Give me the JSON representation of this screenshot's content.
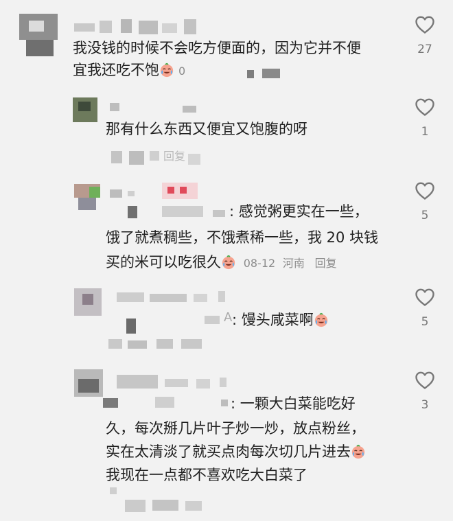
{
  "comments": [
    {
      "text_lines": [
        "我没钱的时候不会吃方便面的，因为它并不便",
        "宜我还吃不饱"
      ],
      "after_emoji": "0",
      "likes": "27"
    },
    {
      "text_lines": [
        "那有什么东西又便宜又饱腹的呀"
      ],
      "reply_fragment": "回复",
      "likes": "1"
    },
    {
      "text_lines": [
        ": 感觉粥更实在一些，",
        "饿了就煮稠些，不饿煮稀一些，我 20 块钱",
        "买的米可以吃很久"
      ],
      "date": "08-12",
      "location": "河南",
      "reply_label": "回复",
      "likes": "5"
    },
    {
      "name_fragment": "A",
      "text_lines": [
        ": 馒头咸菜啊"
      ],
      "likes": "5"
    },
    {
      "text_lines": [
        ": 一颗大白菜能吃好",
        "久，每次掰几片叶子炒一炒，放点粉丝，",
        "实在太清淡了就买点肉每次切几片进去",
        "我现在一点都不喜欢吃大白菜了"
      ],
      "likes": "3"
    }
  ],
  "icons": {
    "like": "heart-outline-icon",
    "emoji": "crying-laugh-emoji-icon"
  },
  "colors": {
    "background": "#f2f2f2",
    "text": "#202020",
    "meta": "#8c8c8c",
    "icon": "#777777"
  }
}
